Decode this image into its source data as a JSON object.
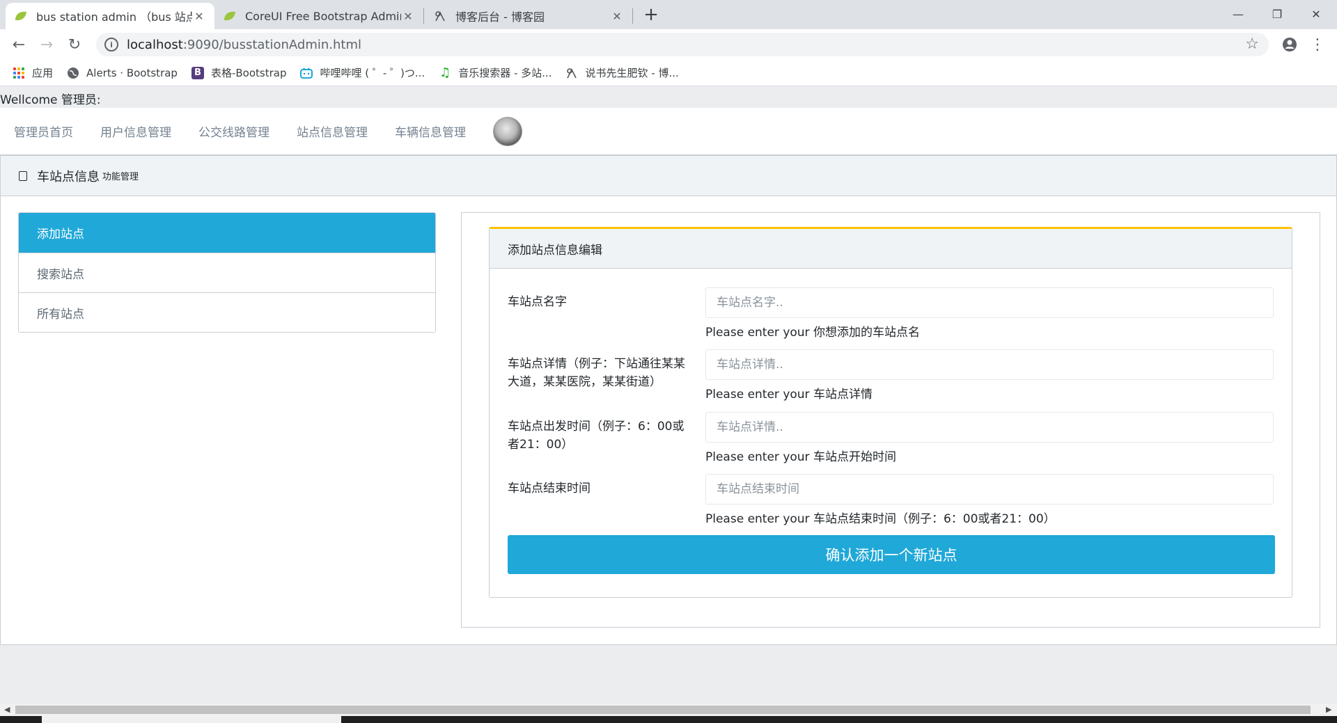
{
  "browser": {
    "tabs": [
      {
        "title": "bus station admin （bus 站点信",
        "close": "✕"
      },
      {
        "title": "CoreUI Free Bootstrap Admin",
        "close": "✕"
      },
      {
        "title": "博客后台 - 博客园",
        "close": "✕"
      }
    ],
    "new_tab": "+",
    "window_controls": {
      "minimize": "—",
      "maximize": "❐",
      "close": "✕"
    },
    "url": {
      "host": "localhost",
      "path": ":9090/busstationAdmin.html"
    },
    "bookmarks": [
      {
        "label": "应用",
        "icon": "apps-icon"
      },
      {
        "label": "Alerts · Bootstrap",
        "icon": "globe-icon"
      },
      {
        "label": "表格-Bootstrap",
        "icon": "bootstrap-icon"
      },
      {
        "label": "哔哩哔哩 ( ゜- ゜)つ...",
        "icon": "bilibili-icon"
      },
      {
        "label": "音乐搜索器 - 多站...",
        "icon": "music-icon"
      },
      {
        "label": "说书先生肥钦 - 博...",
        "icon": "cnblogs-icon"
      }
    ]
  },
  "page": {
    "welcome": "Wellcome 管理员:",
    "nav": [
      "管理员首页",
      "用户信息管理",
      "公交线路管理",
      "站点信息管理",
      "车辆信息管理"
    ],
    "card_header": {
      "title": "车站点信息",
      "subtitle": "功能管理"
    },
    "side_menu": [
      "添加站点",
      "搜索站点",
      "所有站点"
    ],
    "form": {
      "header": "添加站点信息编辑",
      "fields": [
        {
          "label": "车站点名字",
          "placeholder": "车站点名字..",
          "help": "Please enter your 你想添加的车站点名"
        },
        {
          "label": "车站点详情（例子：下站通往某某大道，某某医院，某某街道）",
          "placeholder": "车站点详情..",
          "help": "Please enter your 车站点详情"
        },
        {
          "label": "车站点出发时间（例子：6：00或者21：00）",
          "placeholder": "车站点详情..",
          "help": "Please enter your 车站点开始时间"
        },
        {
          "label": "车站点结束时间",
          "placeholder": "车站点结束时间",
          "help": "Please enter your 车站点结束时间（例子：6：00或者21：00）"
        }
      ],
      "submit": "确认添加一个新站点"
    }
  },
  "colors": {
    "primary": "#20a8d8",
    "warning_accent": "#ffc107",
    "nav_text": "#73818f"
  }
}
